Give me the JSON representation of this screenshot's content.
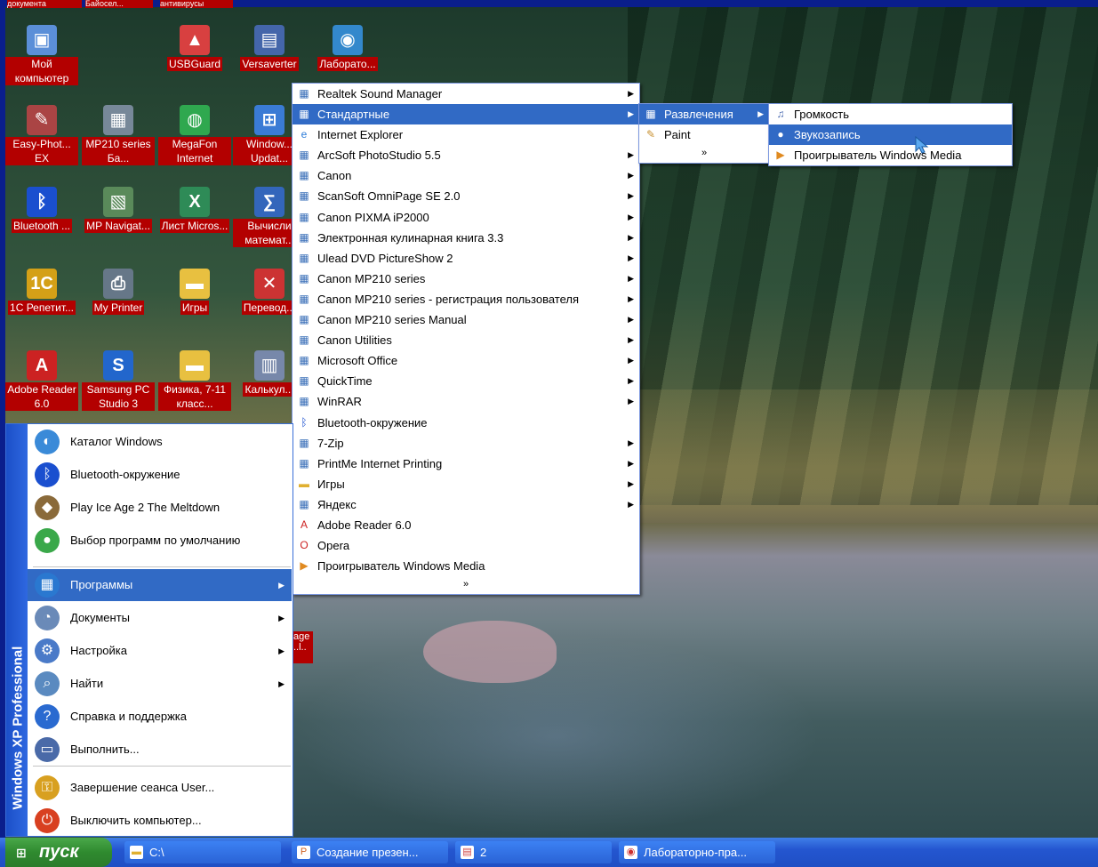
{
  "top_strip": [
    "документа",
    "Байосел...",
    "антивирусы"
  ],
  "desktop_icons": [
    {
      "label": "Мой компьютер",
      "icon": "computer-icon",
      "color": "#5b8fd8",
      "glyph": "▣"
    },
    {
      "label": "USBGuard",
      "icon": "usb-guard-icon",
      "color": "#d84040",
      "glyph": "▲"
    },
    {
      "label": "Versaverter",
      "icon": "versaverter-icon",
      "color": "#4466aa",
      "glyph": "▤"
    },
    {
      "label": "Лаборато...",
      "icon": "lab-icon",
      "color": "#3388cc",
      "glyph": "◉"
    },
    {
      "label": "Easy-Phot... EX",
      "icon": "easyphoto-icon",
      "color": "#aa4444",
      "glyph": "✎"
    },
    {
      "label": "MP210 series Ба...",
      "icon": "printer-icon",
      "color": "#778899",
      "glyph": "▦"
    },
    {
      "label": "MegaFon Internet",
      "icon": "megafon-icon",
      "color": "#2fa84f",
      "glyph": "◍"
    },
    {
      "label": "Window... Updat...",
      "icon": "windows-update-icon",
      "color": "#3a7bd5",
      "glyph": "⊞"
    },
    {
      "label": "Bluetooth ...",
      "icon": "bluetooth-icon",
      "color": "#1a4fcf",
      "glyph": "ᛒ"
    },
    {
      "label": "MP Navigat...",
      "icon": "mp-navigator-icon",
      "color": "#5a8a5a",
      "glyph": "▧"
    },
    {
      "label": "Лист Micros...",
      "icon": "excel-icon",
      "color": "#2e8b57",
      "glyph": "X"
    },
    {
      "label": "Вычисли математ...",
      "icon": "calculator-math-icon",
      "color": "#3366bb",
      "glyph": "∑"
    },
    {
      "label": "1С Репетит...",
      "icon": "1c-icon",
      "color": "#d4a017",
      "glyph": "1С"
    },
    {
      "label": "My Printer",
      "icon": "my-printer-icon",
      "color": "#667788",
      "glyph": "⎙"
    },
    {
      "label": "Игры",
      "icon": "folder-icon",
      "color": "#e8c040",
      "glyph": "▬"
    },
    {
      "label": "Перевод...",
      "icon": "translate-icon",
      "color": "#cc3333",
      "glyph": "✕"
    },
    {
      "label": "Adobe Reader 6.0",
      "icon": "adobe-reader-icon",
      "color": "#cc2222",
      "glyph": "A"
    },
    {
      "label": "Samsung PC Studio 3",
      "icon": "samsung-icon",
      "color": "#2266cc",
      "glyph": "S"
    },
    {
      "label": "Физика, 7-11 класс...",
      "icon": "folder-icon",
      "color": "#e8c040",
      "glyph": "▬"
    },
    {
      "label": "Калькул...",
      "icon": "calculator-icon",
      "color": "#7788aa",
      "glyph": "▥"
    }
  ],
  "hidden_icon_fragment": "age ..l..",
  "programs_menu": {
    "items": [
      {
        "label": "Realtek Sound Manager",
        "icon": "folder-program-icon",
        "sub": true
      },
      {
        "label": "Стандартные",
        "icon": "folder-program-icon",
        "sub": true,
        "selected": true
      },
      {
        "label": "Internet Explorer",
        "icon": "internet-explorer-icon",
        "sub": false
      },
      {
        "label": "ArcSoft PhotoStudio 5.5",
        "icon": "folder-program-icon",
        "sub": true
      },
      {
        "label": "Canon",
        "icon": "folder-program-icon",
        "sub": true
      },
      {
        "label": "ScanSoft OmniPage SE 2.0",
        "icon": "folder-program-icon",
        "sub": true
      },
      {
        "label": "Canon PIXMA iP2000",
        "icon": "folder-program-icon",
        "sub": true
      },
      {
        "label": "Электронная кулинарная книга 3.3",
        "icon": "folder-program-icon",
        "sub": true
      },
      {
        "label": "Ulead DVD PictureShow 2",
        "icon": "folder-program-icon",
        "sub": true
      },
      {
        "label": "Canon MP210 series",
        "icon": "folder-program-icon",
        "sub": true
      },
      {
        "label": "Canon MP210 series - регистрация пользователя",
        "icon": "folder-program-icon",
        "sub": true
      },
      {
        "label": "Canon MP210 series Manual",
        "icon": "folder-program-icon",
        "sub": true
      },
      {
        "label": "Canon Utilities",
        "icon": "folder-program-icon",
        "sub": true
      },
      {
        "label": "Microsoft Office",
        "icon": "folder-program-icon",
        "sub": true
      },
      {
        "label": "QuickTime",
        "icon": "folder-program-icon",
        "sub": true
      },
      {
        "label": "WinRAR",
        "icon": "folder-program-icon",
        "sub": true
      },
      {
        "label": "Bluetooth-окружение",
        "icon": "bluetooth-icon",
        "sub": false
      },
      {
        "label": "7-Zip",
        "icon": "folder-program-icon",
        "sub": true
      },
      {
        "label": "PrintMe Internet Printing",
        "icon": "folder-program-icon",
        "sub": true
      },
      {
        "label": "Игры",
        "icon": "folder-icon",
        "sub": true
      },
      {
        "label": "Яндекс",
        "icon": "folder-program-icon",
        "sub": true
      },
      {
        "label": "Adobe Reader 6.0",
        "icon": "adobe-reader-icon",
        "sub": false
      },
      {
        "label": "Opera",
        "icon": "opera-icon",
        "sub": false
      },
      {
        "label": "Проигрыватель Windows Media",
        "icon": "media-player-icon",
        "sub": false
      }
    ],
    "more": "»"
  },
  "accessories_menu": {
    "items": [
      {
        "label": "Развлечения",
        "icon": "folder-program-icon",
        "sub": true,
        "selected": true
      },
      {
        "label": "Paint",
        "icon": "paint-icon",
        "sub": false
      }
    ],
    "more": "»"
  },
  "entertainment_menu": {
    "items": [
      {
        "label": "Громкость",
        "icon": "volume-icon",
        "selected": false
      },
      {
        "label": "Звукозапись",
        "icon": "sound-recorder-icon",
        "selected": true
      },
      {
        "label": "Проигрыватель Windows Media",
        "icon": "media-player-icon",
        "selected": false
      }
    ]
  },
  "start_menu": {
    "strip_text": "Windows XP Professional",
    "items": [
      {
        "label": "Каталог Windows",
        "icon": "windows-catalog-icon",
        "color": "#3a8ad8",
        "glyph": "◐",
        "sub": false
      },
      {
        "label": "Bluetooth-окружение",
        "icon": "bluetooth-icon",
        "color": "#1a4fcf",
        "glyph": "ᛒ",
        "sub": false
      },
      {
        "label": "Play Ice Age 2 The Meltdown",
        "icon": "ice-age-game-icon",
        "color": "#8a6a3a",
        "glyph": "◆",
        "sub": false
      },
      {
        "label": "Выбор программ по умолчанию",
        "icon": "default-programs-icon",
        "color": "#3aa84a",
        "glyph": "●",
        "sub": false
      },
      {
        "label": "Программы",
        "icon": "programs-icon",
        "color": "#2a78d0",
        "glyph": "▦",
        "sub": true,
        "selected": true
      },
      {
        "label": "Документы",
        "icon": "documents-icon",
        "color": "#6a8ab8",
        "glyph": "◔",
        "sub": true
      },
      {
        "label": "Настройка",
        "icon": "settings-icon",
        "color": "#4a7ac8",
        "glyph": "⚙",
        "sub": true
      },
      {
        "label": "Найти",
        "icon": "search-icon",
        "color": "#5a8ac0",
        "glyph": "⌕",
        "sub": true
      },
      {
        "label": "Справка и поддержка",
        "icon": "help-icon",
        "color": "#2a6ad0",
        "glyph": "?",
        "sub": false
      },
      {
        "label": "Выполнить...",
        "icon": "run-icon",
        "color": "#4a6aa8",
        "glyph": "▭",
        "sub": false
      },
      {
        "label": "Завершение сеанса User...",
        "icon": "logoff-icon",
        "color": "#d8a020",
        "glyph": "⚿",
        "sub": false
      },
      {
        "label": "Выключить компьютер...",
        "icon": "shutdown-icon",
        "color": "#d84020",
        "glyph": "⏻",
        "sub": false
      }
    ]
  },
  "taskbar": {
    "start_label": "пуск",
    "buttons": [
      {
        "label": "C:\\",
        "icon": "folder-icon"
      },
      {
        "label": "Создание презен...",
        "icon": "powerpoint-icon"
      },
      {
        "label": "2",
        "icon": "document-icon"
      },
      {
        "label": "Лабораторно-пра...",
        "icon": "lab-icon"
      }
    ]
  }
}
